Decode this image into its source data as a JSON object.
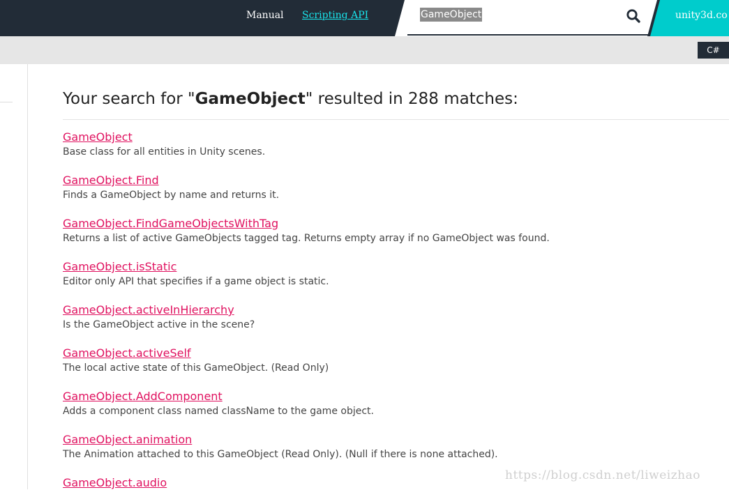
{
  "header": {
    "manual_label": "Manual",
    "scripting_label": "Scripting API",
    "search_value": "GameObject",
    "site_link": "unity3d.co"
  },
  "subheader": {
    "language": "C#"
  },
  "results": {
    "heading_prefix": "Your search for \"",
    "query": "GameObject",
    "heading_suffix": "\" resulted in 288 matches:",
    "items": [
      {
        "title": "GameObject",
        "description": "Base class for all entities in Unity scenes."
      },
      {
        "title": "GameObject.Find",
        "description": "Finds a GameObject by name and returns it."
      },
      {
        "title": "GameObject.FindGameObjectsWithTag",
        "description": "Returns a list of active GameObjects tagged tag. Returns empty array if no GameObject was found."
      },
      {
        "title": "GameObject.isStatic",
        "description": "Editor only API that specifies if a game object is static."
      },
      {
        "title": "GameObject.activeInHierarchy",
        "description": "Is the GameObject active in the scene?"
      },
      {
        "title": "GameObject.activeSelf",
        "description": "The local active state of this GameObject. (Read Only)"
      },
      {
        "title": "GameObject.AddComponent",
        "description": "Adds a component class named className to the game object."
      },
      {
        "title": "GameObject.animation",
        "description": "The Animation attached to this GameObject (Read Only). (Null if there is none attached)."
      },
      {
        "title": "GameObject.audio",
        "description": ""
      }
    ]
  },
  "watermark": "https://blog.csdn.net/liweizhao",
  "colors": {
    "header_bg": "#222c37",
    "accent_cyan": "#00cccc",
    "link_color": "#e0115f",
    "subbar_bg": "#e6e6e6"
  }
}
